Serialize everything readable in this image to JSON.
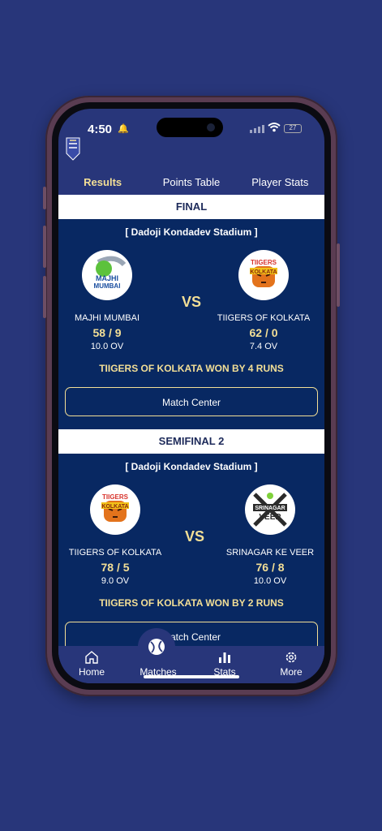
{
  "status_bar": {
    "time": "4:50",
    "battery": "27"
  },
  "tabs": [
    {
      "label": "Results",
      "active": true
    },
    {
      "label": "Points Table",
      "active": false
    },
    {
      "label": "Player Stats",
      "active": false
    }
  ],
  "matches": [
    {
      "stage": "FINAL",
      "venue": "[ Dadoji Kondadev Stadium ]",
      "team1": {
        "name": "MAJHI MUMBAI",
        "logo_text": [
          "MAJHI",
          "MUMBAI"
        ],
        "score": "58 / 9",
        "overs": "10.0 OV"
      },
      "team2": {
        "name": "TIIGERS OF KOLKATA",
        "logo_text": [
          "TIIGERS",
          "KOLKATA"
        ],
        "score": "62 / 0",
        "overs": "7.4 OV"
      },
      "vs": "VS",
      "result": "TIIGERS OF KOLKATA WON BY 4 RUNS",
      "button": "Match Center"
    },
    {
      "stage": "SEMIFINAL 2",
      "venue": "[ Dadoji Kondadev Stadium ]",
      "team1": {
        "name": "TIIGERS OF KOLKATA",
        "logo_text": [
          "TIIGERS",
          "KOLKATA"
        ],
        "score": "78 / 5",
        "overs": "9.0 OV"
      },
      "team2": {
        "name": "SRINAGAR KE VEER",
        "logo_text": [
          "SRINAGAR",
          "VEER"
        ],
        "score": "76 / 8",
        "overs": "10.0 OV"
      },
      "vs": "VS",
      "result": "TIIGERS OF KOLKATA WON BY 2 RUNS",
      "button": "Match Center"
    }
  ],
  "bottom_nav": [
    {
      "label": "Home",
      "icon": "home-icon"
    },
    {
      "label": "Matches",
      "icon": "cricket-ball-icon",
      "active": true
    },
    {
      "label": "Stats",
      "icon": "bar-chart-icon"
    },
    {
      "label": "More",
      "icon": "gear-icon"
    }
  ],
  "colors": {
    "background": "#28367a",
    "card": "#082862",
    "accent": "#f3df96",
    "header_text": "#1d2a5a"
  }
}
